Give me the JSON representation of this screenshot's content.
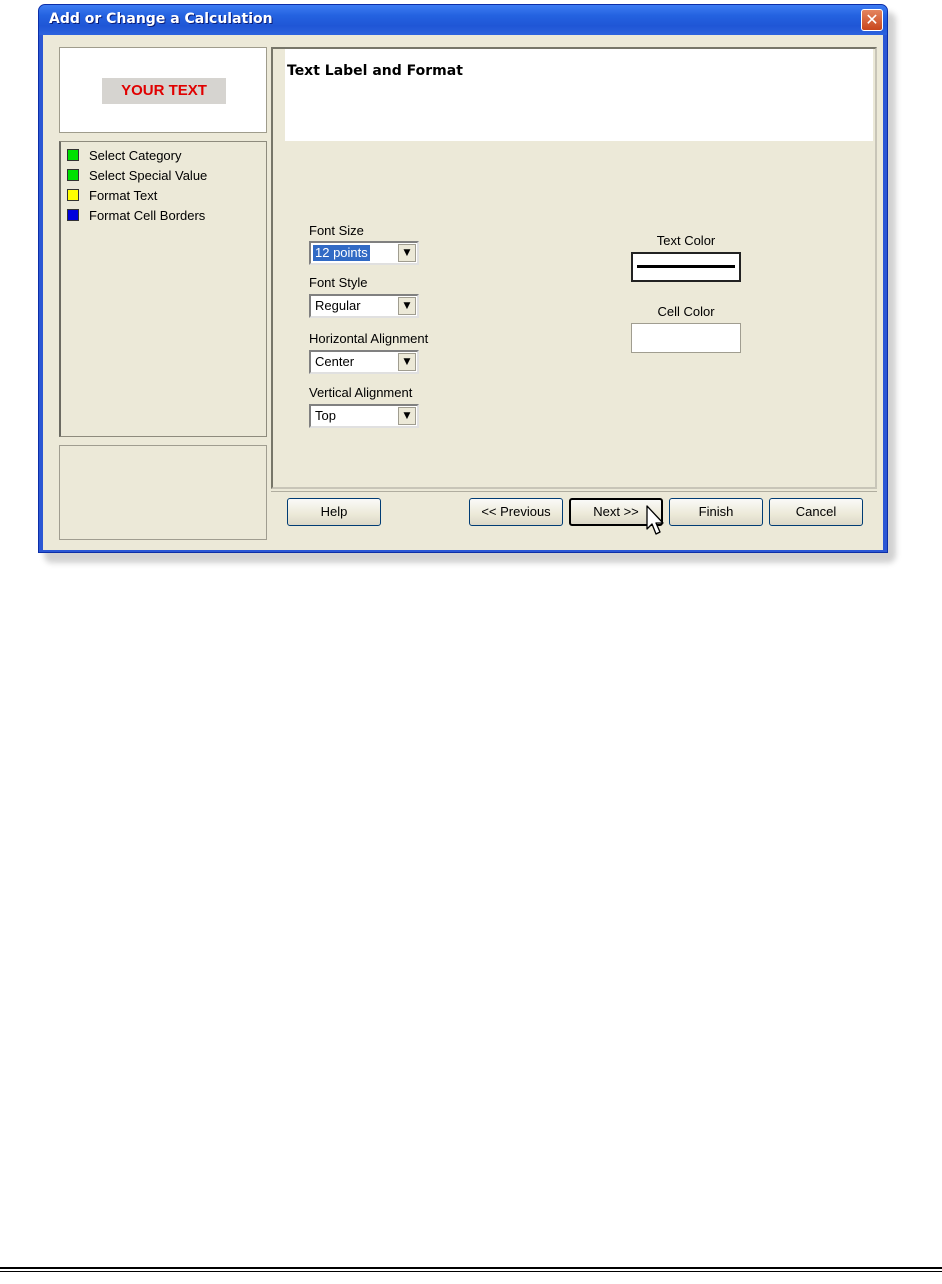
{
  "window": {
    "title": "Add or Change a Calculation",
    "close_glyph": "✕"
  },
  "preview": {
    "text": "YOUR TEXT",
    "text_color": "#e00000"
  },
  "steps": [
    {
      "label": "Select Category",
      "color": "#00e000"
    },
    {
      "label": "Select Special Value",
      "color": "#00e000"
    },
    {
      "label": "Format Text",
      "color": "#ffff00"
    },
    {
      "label": "Format Cell Borders",
      "color": "#0000dd"
    }
  ],
  "content": {
    "title": "Text Label and Format",
    "font_size": {
      "label": "Font Size",
      "value": "12 points"
    },
    "font_style": {
      "label": "Font Style",
      "value": "Regular"
    },
    "horizontal_alignment": {
      "label": "Horizontal Alignment",
      "value": "Center"
    },
    "vertical_alignment": {
      "label": "Vertical Alignment",
      "value": "Top"
    },
    "text_color": {
      "label": "Text Color"
    },
    "cell_color": {
      "label": "Cell Color"
    }
  },
  "footer": {
    "help": "Help",
    "previous": "<< Previous",
    "next": "Next >>",
    "finish": "Finish",
    "cancel": "Cancel"
  },
  "icons": {
    "close": "close-icon",
    "dropdown": "chevron-down-icon",
    "cursor": "mouse-pointer-icon"
  }
}
